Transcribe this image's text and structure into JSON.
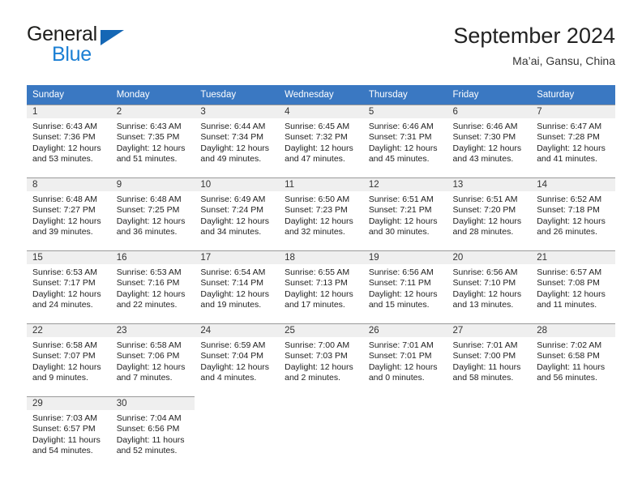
{
  "brand": {
    "name_part1": "General",
    "name_part2": "Blue",
    "color_dark": "#1d1d1b",
    "color_blue": "#1b7fd4"
  },
  "header": {
    "title": "September 2024",
    "location": "Ma’ai, Gansu, China",
    "header_bg": "#3a78c2",
    "daynum_bg": "#efefef"
  },
  "weekdays": [
    "Sunday",
    "Monday",
    "Tuesday",
    "Wednesday",
    "Thursday",
    "Friday",
    "Saturday"
  ],
  "labels": {
    "sunrise_prefix": "Sunrise: ",
    "sunset_prefix": "Sunset: ",
    "daylight_prefix": "Daylight: "
  },
  "weeks": [
    [
      {
        "day": "1",
        "sunrise": "Sunrise: 6:43 AM",
        "sunset": "Sunset: 7:36 PM",
        "daylight_line1": "Daylight: 12 hours",
        "daylight_line2": "and 53 minutes."
      },
      {
        "day": "2",
        "sunrise": "Sunrise: 6:43 AM",
        "sunset": "Sunset: 7:35 PM",
        "daylight_line1": "Daylight: 12 hours",
        "daylight_line2": "and 51 minutes."
      },
      {
        "day": "3",
        "sunrise": "Sunrise: 6:44 AM",
        "sunset": "Sunset: 7:34 PM",
        "daylight_line1": "Daylight: 12 hours",
        "daylight_line2": "and 49 minutes."
      },
      {
        "day": "4",
        "sunrise": "Sunrise: 6:45 AM",
        "sunset": "Sunset: 7:32 PM",
        "daylight_line1": "Daylight: 12 hours",
        "daylight_line2": "and 47 minutes."
      },
      {
        "day": "5",
        "sunrise": "Sunrise: 6:46 AM",
        "sunset": "Sunset: 7:31 PM",
        "daylight_line1": "Daylight: 12 hours",
        "daylight_line2": "and 45 minutes."
      },
      {
        "day": "6",
        "sunrise": "Sunrise: 6:46 AM",
        "sunset": "Sunset: 7:30 PM",
        "daylight_line1": "Daylight: 12 hours",
        "daylight_line2": "and 43 minutes."
      },
      {
        "day": "7",
        "sunrise": "Sunrise: 6:47 AM",
        "sunset": "Sunset: 7:28 PM",
        "daylight_line1": "Daylight: 12 hours",
        "daylight_line2": "and 41 minutes."
      }
    ],
    [
      {
        "day": "8",
        "sunrise": "Sunrise: 6:48 AM",
        "sunset": "Sunset: 7:27 PM",
        "daylight_line1": "Daylight: 12 hours",
        "daylight_line2": "and 39 minutes."
      },
      {
        "day": "9",
        "sunrise": "Sunrise: 6:48 AM",
        "sunset": "Sunset: 7:25 PM",
        "daylight_line1": "Daylight: 12 hours",
        "daylight_line2": "and 36 minutes."
      },
      {
        "day": "10",
        "sunrise": "Sunrise: 6:49 AM",
        "sunset": "Sunset: 7:24 PM",
        "daylight_line1": "Daylight: 12 hours",
        "daylight_line2": "and 34 minutes."
      },
      {
        "day": "11",
        "sunrise": "Sunrise: 6:50 AM",
        "sunset": "Sunset: 7:23 PM",
        "daylight_line1": "Daylight: 12 hours",
        "daylight_line2": "and 32 minutes."
      },
      {
        "day": "12",
        "sunrise": "Sunrise: 6:51 AM",
        "sunset": "Sunset: 7:21 PM",
        "daylight_line1": "Daylight: 12 hours",
        "daylight_line2": "and 30 minutes."
      },
      {
        "day": "13",
        "sunrise": "Sunrise: 6:51 AM",
        "sunset": "Sunset: 7:20 PM",
        "daylight_line1": "Daylight: 12 hours",
        "daylight_line2": "and 28 minutes."
      },
      {
        "day": "14",
        "sunrise": "Sunrise: 6:52 AM",
        "sunset": "Sunset: 7:18 PM",
        "daylight_line1": "Daylight: 12 hours",
        "daylight_line2": "and 26 minutes."
      }
    ],
    [
      {
        "day": "15",
        "sunrise": "Sunrise: 6:53 AM",
        "sunset": "Sunset: 7:17 PM",
        "daylight_line1": "Daylight: 12 hours",
        "daylight_line2": "and 24 minutes."
      },
      {
        "day": "16",
        "sunrise": "Sunrise: 6:53 AM",
        "sunset": "Sunset: 7:16 PM",
        "daylight_line1": "Daylight: 12 hours",
        "daylight_line2": "and 22 minutes."
      },
      {
        "day": "17",
        "sunrise": "Sunrise: 6:54 AM",
        "sunset": "Sunset: 7:14 PM",
        "daylight_line1": "Daylight: 12 hours",
        "daylight_line2": "and 19 minutes."
      },
      {
        "day": "18",
        "sunrise": "Sunrise: 6:55 AM",
        "sunset": "Sunset: 7:13 PM",
        "daylight_line1": "Daylight: 12 hours",
        "daylight_line2": "and 17 minutes."
      },
      {
        "day": "19",
        "sunrise": "Sunrise: 6:56 AM",
        "sunset": "Sunset: 7:11 PM",
        "daylight_line1": "Daylight: 12 hours",
        "daylight_line2": "and 15 minutes."
      },
      {
        "day": "20",
        "sunrise": "Sunrise: 6:56 AM",
        "sunset": "Sunset: 7:10 PM",
        "daylight_line1": "Daylight: 12 hours",
        "daylight_line2": "and 13 minutes."
      },
      {
        "day": "21",
        "sunrise": "Sunrise: 6:57 AM",
        "sunset": "Sunset: 7:08 PM",
        "daylight_line1": "Daylight: 12 hours",
        "daylight_line2": "and 11 minutes."
      }
    ],
    [
      {
        "day": "22",
        "sunrise": "Sunrise: 6:58 AM",
        "sunset": "Sunset: 7:07 PM",
        "daylight_line1": "Daylight: 12 hours",
        "daylight_line2": "and 9 minutes."
      },
      {
        "day": "23",
        "sunrise": "Sunrise: 6:58 AM",
        "sunset": "Sunset: 7:06 PM",
        "daylight_line1": "Daylight: 12 hours",
        "daylight_line2": "and 7 minutes."
      },
      {
        "day": "24",
        "sunrise": "Sunrise: 6:59 AM",
        "sunset": "Sunset: 7:04 PM",
        "daylight_line1": "Daylight: 12 hours",
        "daylight_line2": "and 4 minutes."
      },
      {
        "day": "25",
        "sunrise": "Sunrise: 7:00 AM",
        "sunset": "Sunset: 7:03 PM",
        "daylight_line1": "Daylight: 12 hours",
        "daylight_line2": "and 2 minutes."
      },
      {
        "day": "26",
        "sunrise": "Sunrise: 7:01 AM",
        "sunset": "Sunset: 7:01 PM",
        "daylight_line1": "Daylight: 12 hours",
        "daylight_line2": "and 0 minutes."
      },
      {
        "day": "27",
        "sunrise": "Sunrise: 7:01 AM",
        "sunset": "Sunset: 7:00 PM",
        "daylight_line1": "Daylight: 11 hours",
        "daylight_line2": "and 58 minutes."
      },
      {
        "day": "28",
        "sunrise": "Sunrise: 7:02 AM",
        "sunset": "Sunset: 6:58 PM",
        "daylight_line1": "Daylight: 11 hours",
        "daylight_line2": "and 56 minutes."
      }
    ],
    [
      {
        "day": "29",
        "sunrise": "Sunrise: 7:03 AM",
        "sunset": "Sunset: 6:57 PM",
        "daylight_line1": "Daylight: 11 hours",
        "daylight_line2": "and 54 minutes."
      },
      {
        "day": "30",
        "sunrise": "Sunrise: 7:04 AM",
        "sunset": "Sunset: 6:56 PM",
        "daylight_line1": "Daylight: 11 hours",
        "daylight_line2": "and 52 minutes."
      },
      {
        "day": "",
        "sunrise": "",
        "sunset": "",
        "daylight_line1": "",
        "daylight_line2": ""
      },
      {
        "day": "",
        "sunrise": "",
        "sunset": "",
        "daylight_line1": "",
        "daylight_line2": ""
      },
      {
        "day": "",
        "sunrise": "",
        "sunset": "",
        "daylight_line1": "",
        "daylight_line2": ""
      },
      {
        "day": "",
        "sunrise": "",
        "sunset": "",
        "daylight_line1": "",
        "daylight_line2": ""
      },
      {
        "day": "",
        "sunrise": "",
        "sunset": "",
        "daylight_line1": "",
        "daylight_line2": ""
      }
    ]
  ]
}
